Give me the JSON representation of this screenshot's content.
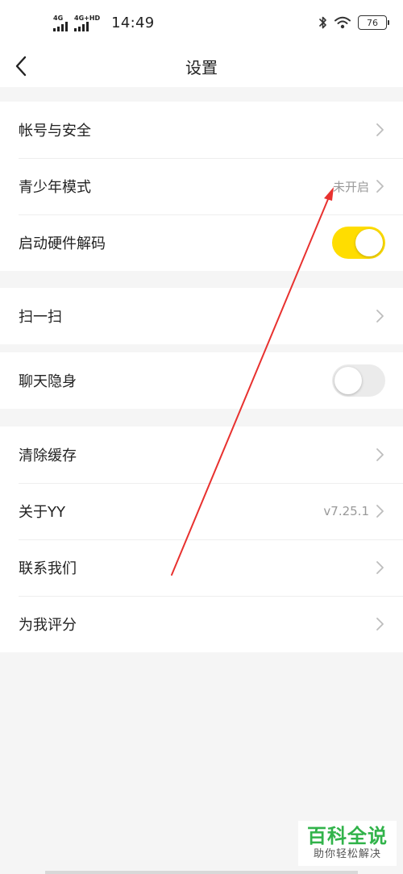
{
  "status_bar": {
    "signal_1": "4G",
    "signal_2": "4G+HD",
    "time": "14:49",
    "battery": "76",
    "icons": [
      "bluetooth-icon",
      "wifi-icon",
      "battery-icon"
    ]
  },
  "nav": {
    "title": "设置",
    "back_icon": "chevron-left-icon"
  },
  "groups": [
    [
      {
        "label": "帐号与安全",
        "value": "",
        "control": "chevron"
      },
      {
        "label": "青少年模式",
        "value": "未开启",
        "control": "chevron"
      },
      {
        "label": "启动硬件解码",
        "value": "",
        "control": "toggle",
        "toggle_on": true
      }
    ],
    [
      {
        "label": "扫一扫",
        "value": "",
        "control": "chevron"
      }
    ],
    [
      {
        "label": "聊天隐身",
        "value": "",
        "control": "toggle",
        "toggle_on": false
      }
    ],
    [
      {
        "label": "清除缓存",
        "value": "",
        "control": "chevron"
      },
      {
        "label": "关于YY",
        "value": "v7.25.1",
        "control": "chevron"
      },
      {
        "label": "联系我们",
        "value": "",
        "control": "chevron"
      },
      {
        "label": "为我评分",
        "value": "",
        "control": "chevron"
      }
    ]
  ],
  "watermark": {
    "title": "百科全说",
    "subtitle": "助你轻松解决"
  },
  "colors": {
    "accent_toggle": "#ffdd00",
    "annotation_arrow": "#e8312f",
    "watermark_green": "#31b34a"
  }
}
